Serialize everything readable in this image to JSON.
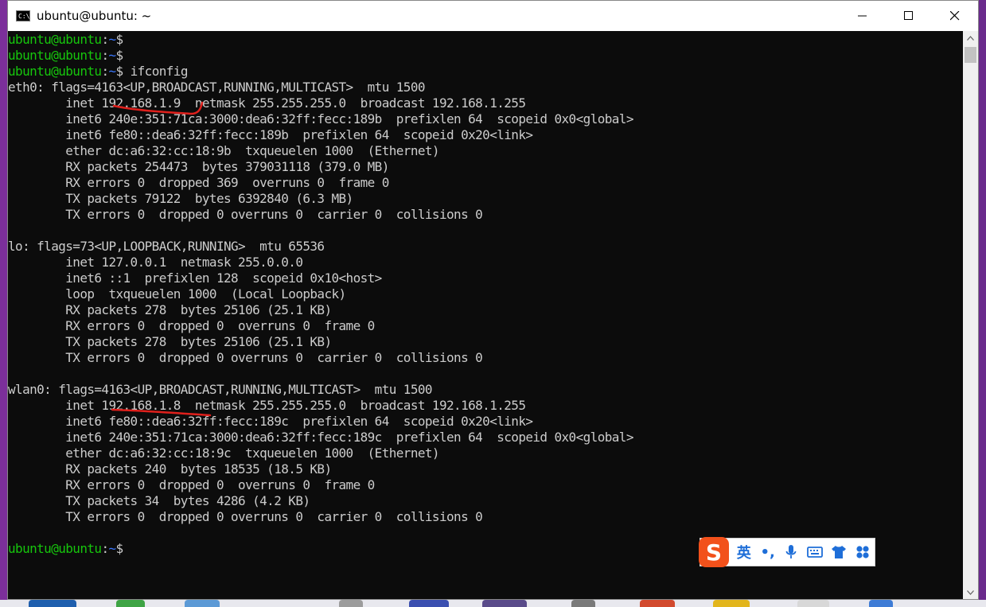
{
  "window": {
    "title": "ubuntu@ubuntu: ~",
    "icon": "cmd-console-icon",
    "icon_label": "C:\\.",
    "controls": [
      "minimize-icon",
      "maximize-icon",
      "close-icon"
    ]
  },
  "prompt": {
    "user": "ubuntu@ubuntu",
    "path": "~",
    "symbol": "$"
  },
  "terminal": {
    "lines": [
      {
        "type": "prompt",
        "cmd": ""
      },
      {
        "type": "prompt",
        "cmd": ""
      },
      {
        "type": "prompt",
        "cmd": "ifconfig"
      },
      {
        "type": "text",
        "text": "eth0: flags=4163<UP,BROADCAST,RUNNING,MULTICAST>  mtu 1500"
      },
      {
        "type": "text",
        "text": "        inet 192.168.1.9  netmask 255.255.255.0  broadcast 192.168.1.255"
      },
      {
        "type": "text",
        "text": "        inet6 240e:351:71ca:3000:dea6:32ff:fecc:189b  prefixlen 64  scopeid 0x0<global>"
      },
      {
        "type": "text",
        "text": "        inet6 fe80::dea6:32ff:fecc:189b  prefixlen 64  scopeid 0x20<link>"
      },
      {
        "type": "text",
        "text": "        ether dc:a6:32:cc:18:9b  txqueuelen 1000  (Ethernet)"
      },
      {
        "type": "text",
        "text": "        RX packets 254473  bytes 379031118 (379.0 MB)"
      },
      {
        "type": "text",
        "text": "        RX errors 0  dropped 369  overruns 0  frame 0"
      },
      {
        "type": "text",
        "text": "        TX packets 79122  bytes 6392840 (6.3 MB)"
      },
      {
        "type": "text",
        "text": "        TX errors 0  dropped 0 overruns 0  carrier 0  collisions 0"
      },
      {
        "type": "text",
        "text": ""
      },
      {
        "type": "text",
        "text": "lo: flags=73<UP,LOOPBACK,RUNNING>  mtu 65536"
      },
      {
        "type": "text",
        "text": "        inet 127.0.0.1  netmask 255.0.0.0"
      },
      {
        "type": "text",
        "text": "        inet6 ::1  prefixlen 128  scopeid 0x10<host>"
      },
      {
        "type": "text",
        "text": "        loop  txqueuelen 1000  (Local Loopback)"
      },
      {
        "type": "text",
        "text": "        RX packets 278  bytes 25106 (25.1 KB)"
      },
      {
        "type": "text",
        "text": "        RX errors 0  dropped 0  overruns 0  frame 0"
      },
      {
        "type": "text",
        "text": "        TX packets 278  bytes 25106 (25.1 KB)"
      },
      {
        "type": "text",
        "text": "        TX errors 0  dropped 0 overruns 0  carrier 0  collisions 0"
      },
      {
        "type": "text",
        "text": ""
      },
      {
        "type": "text",
        "text": "wlan0: flags=4163<UP,BROADCAST,RUNNING,MULTICAST>  mtu 1500"
      },
      {
        "type": "text",
        "text": "        inet 192.168.1.8  netmask 255.255.255.0  broadcast 192.168.1.255"
      },
      {
        "type": "text",
        "text": "        inet6 fe80::dea6:32ff:fecc:189c  prefixlen 64  scopeid 0x20<link>"
      },
      {
        "type": "text",
        "text": "        inet6 240e:351:71ca:3000:dea6:32ff:fecc:189c  prefixlen 64  scopeid 0x0<global>"
      },
      {
        "type": "text",
        "text": "        ether dc:a6:32:cc:18:9c  txqueuelen 1000  (Ethernet)"
      },
      {
        "type": "text",
        "text": "        RX packets 240  bytes 18535 (18.5 KB)"
      },
      {
        "type": "text",
        "text": "        RX errors 0  dropped 0  overruns 0  frame 0"
      },
      {
        "type": "text",
        "text": "        TX packets 34  bytes 4286 (4.2 KB)"
      },
      {
        "type": "text",
        "text": "        TX errors 0  dropped 0 overruns 0  carrier 0  collisions 0"
      },
      {
        "type": "text",
        "text": ""
      },
      {
        "type": "prompt",
        "cmd": ""
      }
    ]
  },
  "colors": {
    "background": "#0c0c0c",
    "text": "#cccccc",
    "prompt_user": "#16c60c",
    "prompt_path": "#3b78ff",
    "annotation": "#e0201c"
  },
  "ime_toolbar": {
    "logo": "S",
    "mode": "英",
    "punct": "•,",
    "icons": [
      "sogou-logo-icon",
      "microphone-icon",
      "keyboard-icon",
      "skin-shirt-icon",
      "toolbox-grid-icon"
    ]
  }
}
